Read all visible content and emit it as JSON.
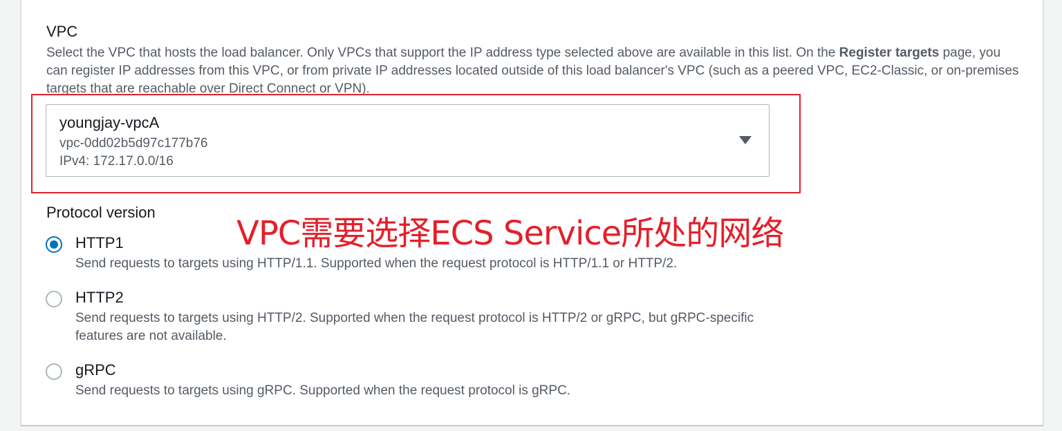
{
  "vpc": {
    "label": "VPC",
    "description_part1": "Select the VPC that hosts the load balancer. Only VPCs that support the IP address type selected above are available in this list. On the ",
    "description_bold": "Register targets",
    "description_part2": " page, you can register IP addresses from this VPC, or from private IP addresses located outside of this load balancer's VPC (such as a peered VPC, EC2-Classic, or on-premises targets that are reachable over Direct Connect or VPN).",
    "selected": {
      "name": "youngjay-vpcA",
      "id": "vpc-0dd02b5d97c177b76",
      "cidr": "IPv4: 172.17.0.0/16"
    }
  },
  "annotation": {
    "text": "VPC需要选择ECS Service所处的网络",
    "color": "#e3202b"
  },
  "protocol": {
    "label": "Protocol version",
    "options": [
      {
        "title": "HTTP1",
        "description": "Send requests to targets using HTTP/1.1. Supported when the request protocol is HTTP/1.1 or HTTP/2.",
        "checked": true
      },
      {
        "title": "HTTP2",
        "description": "Send requests to targets using HTTP/2. Supported when the request protocol is HTTP/2 or gRPC, but gRPC-specific features are not available.",
        "checked": false
      },
      {
        "title": "gRPC",
        "description": "Send requests to targets using gRPC. Supported when the request protocol is gRPC.",
        "checked": false
      }
    ]
  },
  "colors": {
    "accent": "#0073bb",
    "highlight": "#e3202b"
  }
}
